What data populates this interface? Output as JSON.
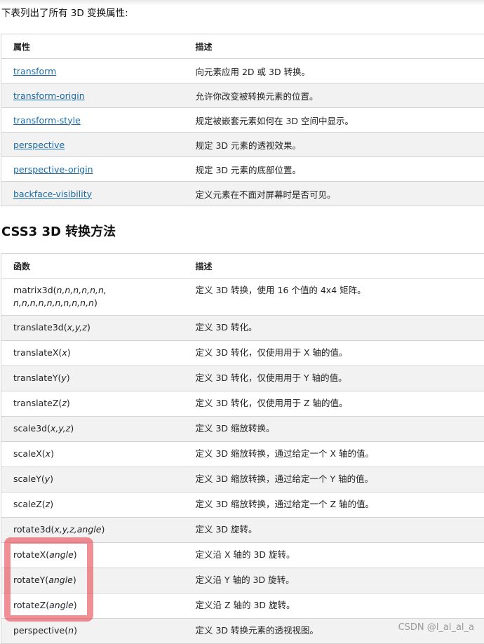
{
  "intro": "下表列出了所有 3D 变换属性:",
  "props_table": {
    "headers": [
      "属性",
      "描述"
    ],
    "rows": [
      {
        "name": "transform",
        "desc": "向元素应用 2D 或 3D 转换。"
      },
      {
        "name": "transform-origin",
        "desc": "允许你改变被转换元素的位置。"
      },
      {
        "name": "transform-style",
        "desc": "规定被嵌套元素如何在 3D 空间中显示。"
      },
      {
        "name": "perspective",
        "desc": "规定 3D 元素的透视效果。"
      },
      {
        "name": "perspective-origin",
        "desc": "规定 3D 元素的底部位置。"
      },
      {
        "name": "backface-visibility",
        "desc": "定义元素在不面对屏幕时是否可见。"
      }
    ]
  },
  "section_title": "CSS3 3D 转换方法",
  "methods_table": {
    "headers": [
      "函数",
      "描述"
    ],
    "rows": [
      {
        "fn": "matrix3d(",
        "args": "n,n,n,n,n,n,",
        "fn2": "",
        "args2": "n,n,n,n,n,n,n,n,n,n",
        "close": ")",
        "desc": "定义 3D 转换，使用 16 个值的 4x4 矩阵。"
      },
      {
        "fn": "translate3d(",
        "args": "x,y,z",
        "close": ")",
        "desc": "定义 3D 转化。"
      },
      {
        "fn": "translateX(",
        "args": "x",
        "close": ")",
        "desc": "定义 3D 转化，仅使用用于 X 轴的值。"
      },
      {
        "fn": "translateY(",
        "args": "y",
        "close": ")",
        "desc": "定义 3D 转化，仅使用用于 Y 轴的值。"
      },
      {
        "fn": "translateZ(",
        "args": "z",
        "close": ")",
        "desc": "定义 3D 转化，仅使用用于 Z 轴的值。"
      },
      {
        "fn": "scale3d(",
        "args": "x,y,z",
        "close": ")",
        "desc": "定义 3D 缩放转换。"
      },
      {
        "fn": "scaleX(",
        "args": "x",
        "close": ")",
        "desc": "定义 3D 缩放转换，通过给定一个 X 轴的值。"
      },
      {
        "fn": "scaleY(",
        "args": "y",
        "close": ")",
        "desc": "定义 3D 缩放转换，通过给定一个 Y 轴的值。"
      },
      {
        "fn": "scaleZ(",
        "args": "z",
        "close": ")",
        "desc": "定义 3D 缩放转换，通过给定一个 Z 轴的值。"
      },
      {
        "fn": "rotate3d(",
        "args": "x,y,z,angle",
        "close": ")",
        "desc": "定义 3D 旋转。"
      },
      {
        "fn": "rotateX(",
        "args": "angle",
        "close": ")",
        "desc": "定义沿 X 轴的 3D 旋转。"
      },
      {
        "fn": "rotateY(",
        "args": "angle",
        "close": ")",
        "desc": "定义沿 Y 轴的 3D 旋转。"
      },
      {
        "fn": "rotateZ(",
        "args": "angle",
        "close": ")",
        "desc": "定义沿 Z 轴的 3D 旋转。"
      },
      {
        "fn": "perspective(",
        "args": "n",
        "close": ")",
        "desc": "定义 3D 转换元素的透视视图。"
      }
    ]
  },
  "watermark": "CSDN @l_al_al_a"
}
